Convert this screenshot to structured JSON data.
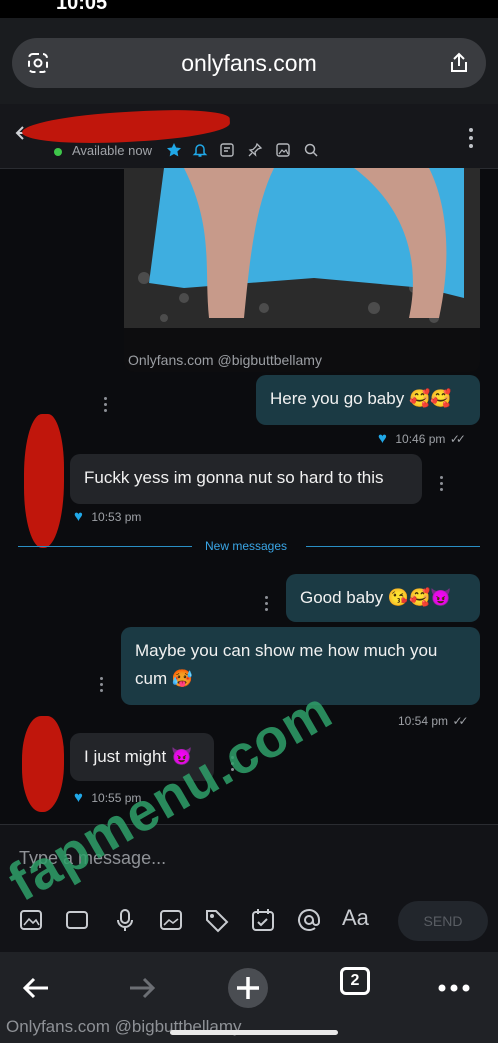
{
  "status_bar": {
    "time": "10:05"
  },
  "browser": {
    "url": "onlyfans.com"
  },
  "chat_header": {
    "status": "Available now"
  },
  "media": {
    "caption": "Onlyfans.com @bigbuttbellamy"
  },
  "messages": [
    {
      "text": "Here you go baby",
      "emoji": "🥰🥰",
      "time": "10:46 pm"
    },
    {
      "text": "Fuckk yess im gonna nut so hard to this",
      "time": "10:53 pm"
    },
    {
      "separator": "New messages"
    },
    {
      "text": "Good baby",
      "emoji": "😘🥰😈"
    },
    {
      "text": "Maybe you can show me how much you cum",
      "emoji": "🥵",
      "time": "10:54 pm"
    },
    {
      "text": "I just might",
      "emoji": "😈",
      "time": "10:55 pm"
    }
  ],
  "composer": {
    "placeholder": "Type a message...",
    "send_label": "SEND",
    "text_tool_label": "Aa"
  },
  "watermark": "fapmenu.com",
  "nav": {
    "tab_count": "2"
  },
  "footer_caption": "Onlyfans.com @bigbuttbellamy",
  "colors": {
    "accent": "#20a8e8",
    "outgoing_bubble": "#1b3a44",
    "incoming_bubble": "#232529",
    "redaction": "#c0160c"
  },
  "icons": [
    "back-arrow-icon",
    "star-icon",
    "bell-icon",
    "note-icon",
    "pin-icon",
    "image-icon",
    "search-icon",
    "share-icon",
    "site-settings-icon",
    "plus-icon",
    "forward-arrow-icon",
    "tabs-icon",
    "more-icon"
  ]
}
